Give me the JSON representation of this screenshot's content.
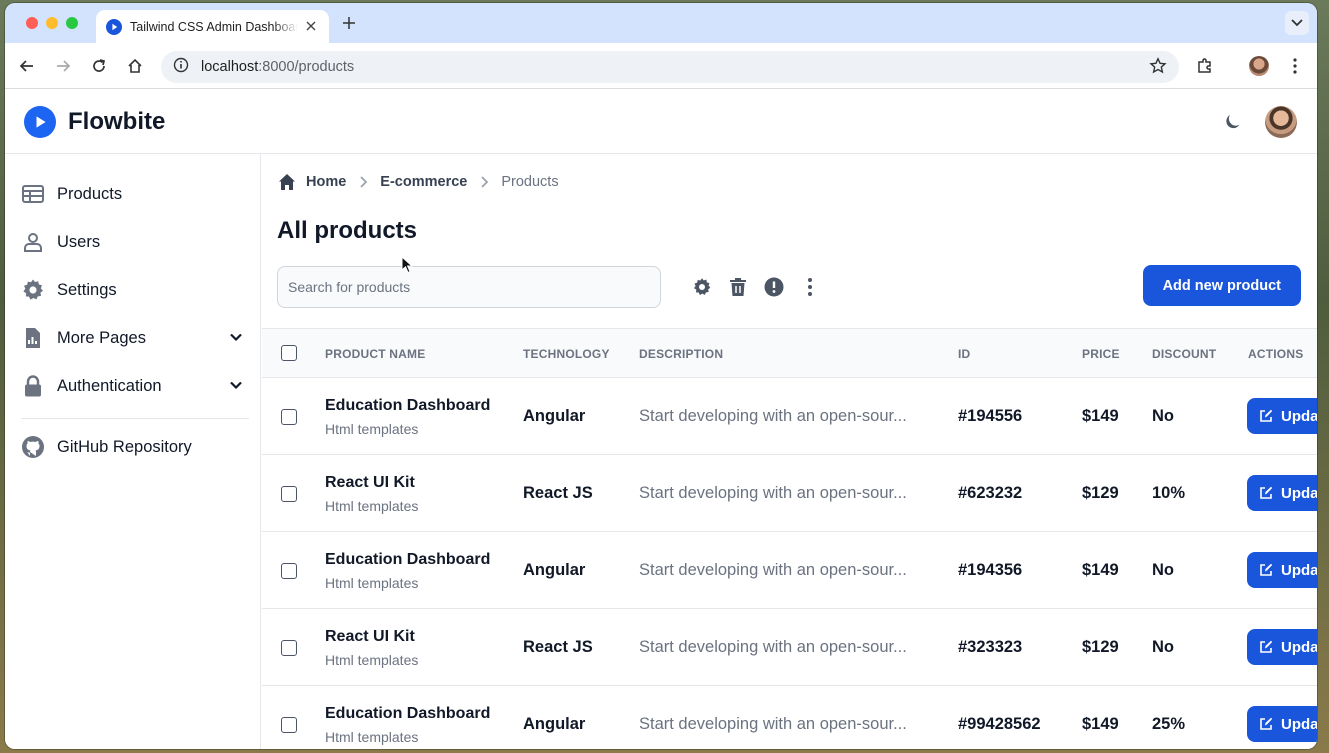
{
  "browser": {
    "tab_title": "Tailwind CSS Admin Dashboard",
    "url_host": "localhost",
    "url_rest": ":8000/products"
  },
  "app": {
    "brand": "Flowbite"
  },
  "sidebar": {
    "items": [
      {
        "label": "Products",
        "icon": "table-icon"
      },
      {
        "label": "Users",
        "icon": "user-icon"
      },
      {
        "label": "Settings",
        "icon": "gear-icon"
      },
      {
        "label": "More Pages",
        "icon": "document-icon",
        "expandable": true
      },
      {
        "label": "Authentication",
        "icon": "lock-icon",
        "expandable": true
      },
      {
        "label": "GitHub Repository",
        "icon": "github-icon"
      }
    ]
  },
  "breadcrumb": {
    "home": "Home",
    "ecommerce": "E-commerce",
    "current": "Products"
  },
  "page": {
    "title": "All products",
    "search_placeholder": "Search for products",
    "add_button": "Add new product"
  },
  "table": {
    "headers": {
      "name": "PRODUCT NAME",
      "technology": "TECHNOLOGY",
      "description": "DESCRIPTION",
      "id": "ID",
      "price": "PRICE",
      "discount": "DISCOUNT",
      "actions": "ACTIONS"
    },
    "rows": [
      {
        "name": "Education Dashboard",
        "category": "Html templates",
        "technology": "Angular",
        "description": "Start developing with an open-sour...",
        "id": "#194556",
        "price": "$149",
        "discount": "No",
        "action": "Upda"
      },
      {
        "name": "React UI Kit",
        "category": "Html templates",
        "technology": "React JS",
        "description": "Start developing with an open-sour...",
        "id": "#623232",
        "price": "$129",
        "discount": "10%",
        "action": "Upda"
      },
      {
        "name": "Education Dashboard",
        "category": "Html templates",
        "technology": "Angular",
        "description": "Start developing with an open-sour...",
        "id": "#194356",
        "price": "$149",
        "discount": "No",
        "action": "Upda"
      },
      {
        "name": "React UI Kit",
        "category": "Html templates",
        "technology": "React JS",
        "description": "Start developing with an open-sour...",
        "id": "#323323",
        "price": "$129",
        "discount": "No",
        "action": "Upda"
      },
      {
        "name": "Education Dashboard",
        "category": "Html templates",
        "technology": "Angular",
        "description": "Start developing with an open-sour...",
        "id": "#99428562",
        "price": "$149",
        "discount": "25%",
        "action": "Upda"
      }
    ]
  },
  "colors": {
    "primary": "#1a56db",
    "tabbar": "#d3e3fd"
  }
}
